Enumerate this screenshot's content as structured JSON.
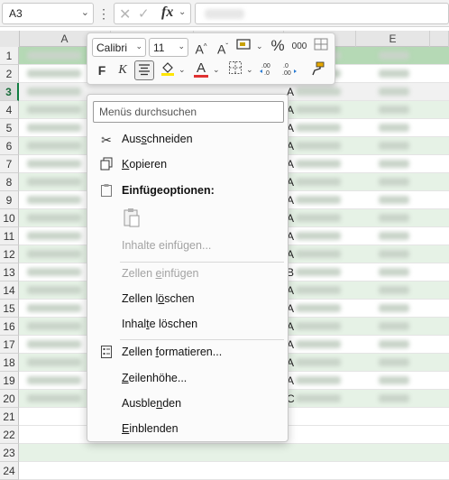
{
  "formula_bar": {
    "name_box": "A3",
    "more": "⋮",
    "cancel": "✕",
    "confirm": "✓",
    "fx": "fx"
  },
  "columns": [
    {
      "key": "a",
      "label": "A"
    },
    {
      "key": "e",
      "label": "E"
    }
  ],
  "rows": [
    "1",
    "2",
    "3",
    "4",
    "5",
    "6",
    "7",
    "8",
    "9",
    "10",
    "11",
    "12",
    "13",
    "14",
    "15",
    "16",
    "17",
    "18",
    "19",
    "20",
    "21",
    "22",
    "23",
    "24"
  ],
  "selected_row": "3",
  "visible_cell_letters": [
    "A",
    "A",
    "A",
    "A",
    "A",
    "A",
    "A",
    "A",
    "A",
    "A",
    "B",
    "A",
    "A",
    "A",
    "A",
    "A",
    "A",
    "C"
  ],
  "mini_toolbar": {
    "font_name": "Calibri",
    "font_size": "11",
    "grow_font": "A^",
    "shrink_font": "Aˇ",
    "number_format": "%",
    "thousands": "000",
    "bold": "F",
    "italic": "K",
    "font_color_letter": "A",
    "accent_font_color": "#e03131",
    "accent_fill_color": "#ffe600"
  },
  "context_menu": {
    "search_placeholder": "Menüs durchsuchen",
    "cut": {
      "pre": "Aus",
      "key": "s",
      "post": "chneiden"
    },
    "copy": {
      "pre": "",
      "key": "K",
      "post": "opieren"
    },
    "paste_options": "Einfügeoptionen:",
    "paste_special": "Inhalte einfügen...",
    "insert_cells": {
      "pre": "Zellen ",
      "key": "e",
      "post": "infügen"
    },
    "delete_cells": {
      "pre": "Zellen l",
      "key": "ö",
      "post": "schen"
    },
    "clear_contents": {
      "pre": "Inhal",
      "key": "t",
      "post": "e löschen"
    },
    "format_cells": {
      "pre": "Zellen ",
      "key": "f",
      "post": "ormatieren..."
    },
    "row_height": {
      "pre": "",
      "key": "Z",
      "post": "eilenhöhe..."
    },
    "hide": {
      "pre": "Ausble",
      "key": "n",
      "post": "den"
    },
    "unhide": {
      "pre": "",
      "key": "E",
      "post": "inblenden"
    }
  },
  "colors": {
    "excel_green": "#107c41",
    "row_band_green": "#e6f2e6",
    "header_row_green": "#b5d9b5"
  }
}
